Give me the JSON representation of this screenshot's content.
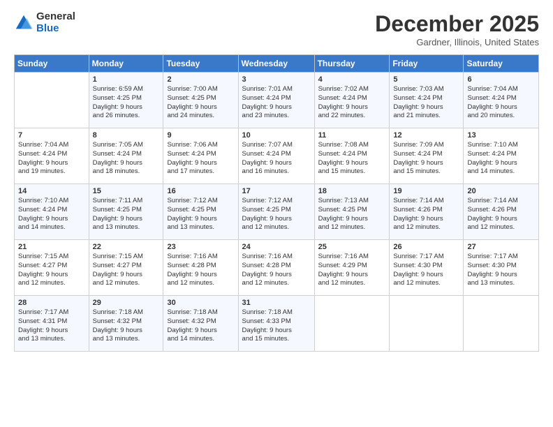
{
  "logo": {
    "general": "General",
    "blue": "Blue"
  },
  "title": "December 2025",
  "location": "Gardner, Illinois, United States",
  "days_header": [
    "Sunday",
    "Monday",
    "Tuesday",
    "Wednesday",
    "Thursday",
    "Friday",
    "Saturday"
  ],
  "weeks": [
    [
      {
        "num": "",
        "info": ""
      },
      {
        "num": "1",
        "info": "Sunrise: 6:59 AM\nSunset: 4:25 PM\nDaylight: 9 hours\nand 26 minutes."
      },
      {
        "num": "2",
        "info": "Sunrise: 7:00 AM\nSunset: 4:25 PM\nDaylight: 9 hours\nand 24 minutes."
      },
      {
        "num": "3",
        "info": "Sunrise: 7:01 AM\nSunset: 4:24 PM\nDaylight: 9 hours\nand 23 minutes."
      },
      {
        "num": "4",
        "info": "Sunrise: 7:02 AM\nSunset: 4:24 PM\nDaylight: 9 hours\nand 22 minutes."
      },
      {
        "num": "5",
        "info": "Sunrise: 7:03 AM\nSunset: 4:24 PM\nDaylight: 9 hours\nand 21 minutes."
      },
      {
        "num": "6",
        "info": "Sunrise: 7:04 AM\nSunset: 4:24 PM\nDaylight: 9 hours\nand 20 minutes."
      }
    ],
    [
      {
        "num": "7",
        "info": "Sunrise: 7:04 AM\nSunset: 4:24 PM\nDaylight: 9 hours\nand 19 minutes."
      },
      {
        "num": "8",
        "info": "Sunrise: 7:05 AM\nSunset: 4:24 PM\nDaylight: 9 hours\nand 18 minutes."
      },
      {
        "num": "9",
        "info": "Sunrise: 7:06 AM\nSunset: 4:24 PM\nDaylight: 9 hours\nand 17 minutes."
      },
      {
        "num": "10",
        "info": "Sunrise: 7:07 AM\nSunset: 4:24 PM\nDaylight: 9 hours\nand 16 minutes."
      },
      {
        "num": "11",
        "info": "Sunrise: 7:08 AM\nSunset: 4:24 PM\nDaylight: 9 hours\nand 15 minutes."
      },
      {
        "num": "12",
        "info": "Sunrise: 7:09 AM\nSunset: 4:24 PM\nDaylight: 9 hours\nand 15 minutes."
      },
      {
        "num": "13",
        "info": "Sunrise: 7:10 AM\nSunset: 4:24 PM\nDaylight: 9 hours\nand 14 minutes."
      }
    ],
    [
      {
        "num": "14",
        "info": "Sunrise: 7:10 AM\nSunset: 4:24 PM\nDaylight: 9 hours\nand 14 minutes."
      },
      {
        "num": "15",
        "info": "Sunrise: 7:11 AM\nSunset: 4:25 PM\nDaylight: 9 hours\nand 13 minutes."
      },
      {
        "num": "16",
        "info": "Sunrise: 7:12 AM\nSunset: 4:25 PM\nDaylight: 9 hours\nand 13 minutes."
      },
      {
        "num": "17",
        "info": "Sunrise: 7:12 AM\nSunset: 4:25 PM\nDaylight: 9 hours\nand 12 minutes."
      },
      {
        "num": "18",
        "info": "Sunrise: 7:13 AM\nSunset: 4:25 PM\nDaylight: 9 hours\nand 12 minutes."
      },
      {
        "num": "19",
        "info": "Sunrise: 7:14 AM\nSunset: 4:26 PM\nDaylight: 9 hours\nand 12 minutes."
      },
      {
        "num": "20",
        "info": "Sunrise: 7:14 AM\nSunset: 4:26 PM\nDaylight: 9 hours\nand 12 minutes."
      }
    ],
    [
      {
        "num": "21",
        "info": "Sunrise: 7:15 AM\nSunset: 4:27 PM\nDaylight: 9 hours\nand 12 minutes."
      },
      {
        "num": "22",
        "info": "Sunrise: 7:15 AM\nSunset: 4:27 PM\nDaylight: 9 hours\nand 12 minutes."
      },
      {
        "num": "23",
        "info": "Sunrise: 7:16 AM\nSunset: 4:28 PM\nDaylight: 9 hours\nand 12 minutes."
      },
      {
        "num": "24",
        "info": "Sunrise: 7:16 AM\nSunset: 4:28 PM\nDaylight: 9 hours\nand 12 minutes."
      },
      {
        "num": "25",
        "info": "Sunrise: 7:16 AM\nSunset: 4:29 PM\nDaylight: 9 hours\nand 12 minutes."
      },
      {
        "num": "26",
        "info": "Sunrise: 7:17 AM\nSunset: 4:30 PM\nDaylight: 9 hours\nand 12 minutes."
      },
      {
        "num": "27",
        "info": "Sunrise: 7:17 AM\nSunset: 4:30 PM\nDaylight: 9 hours\nand 13 minutes."
      }
    ],
    [
      {
        "num": "28",
        "info": "Sunrise: 7:17 AM\nSunset: 4:31 PM\nDaylight: 9 hours\nand 13 minutes."
      },
      {
        "num": "29",
        "info": "Sunrise: 7:18 AM\nSunset: 4:32 PM\nDaylight: 9 hours\nand 13 minutes."
      },
      {
        "num": "30",
        "info": "Sunrise: 7:18 AM\nSunset: 4:32 PM\nDaylight: 9 hours\nand 14 minutes."
      },
      {
        "num": "31",
        "info": "Sunrise: 7:18 AM\nSunset: 4:33 PM\nDaylight: 9 hours\nand 15 minutes."
      },
      {
        "num": "",
        "info": ""
      },
      {
        "num": "",
        "info": ""
      },
      {
        "num": "",
        "info": ""
      }
    ]
  ]
}
